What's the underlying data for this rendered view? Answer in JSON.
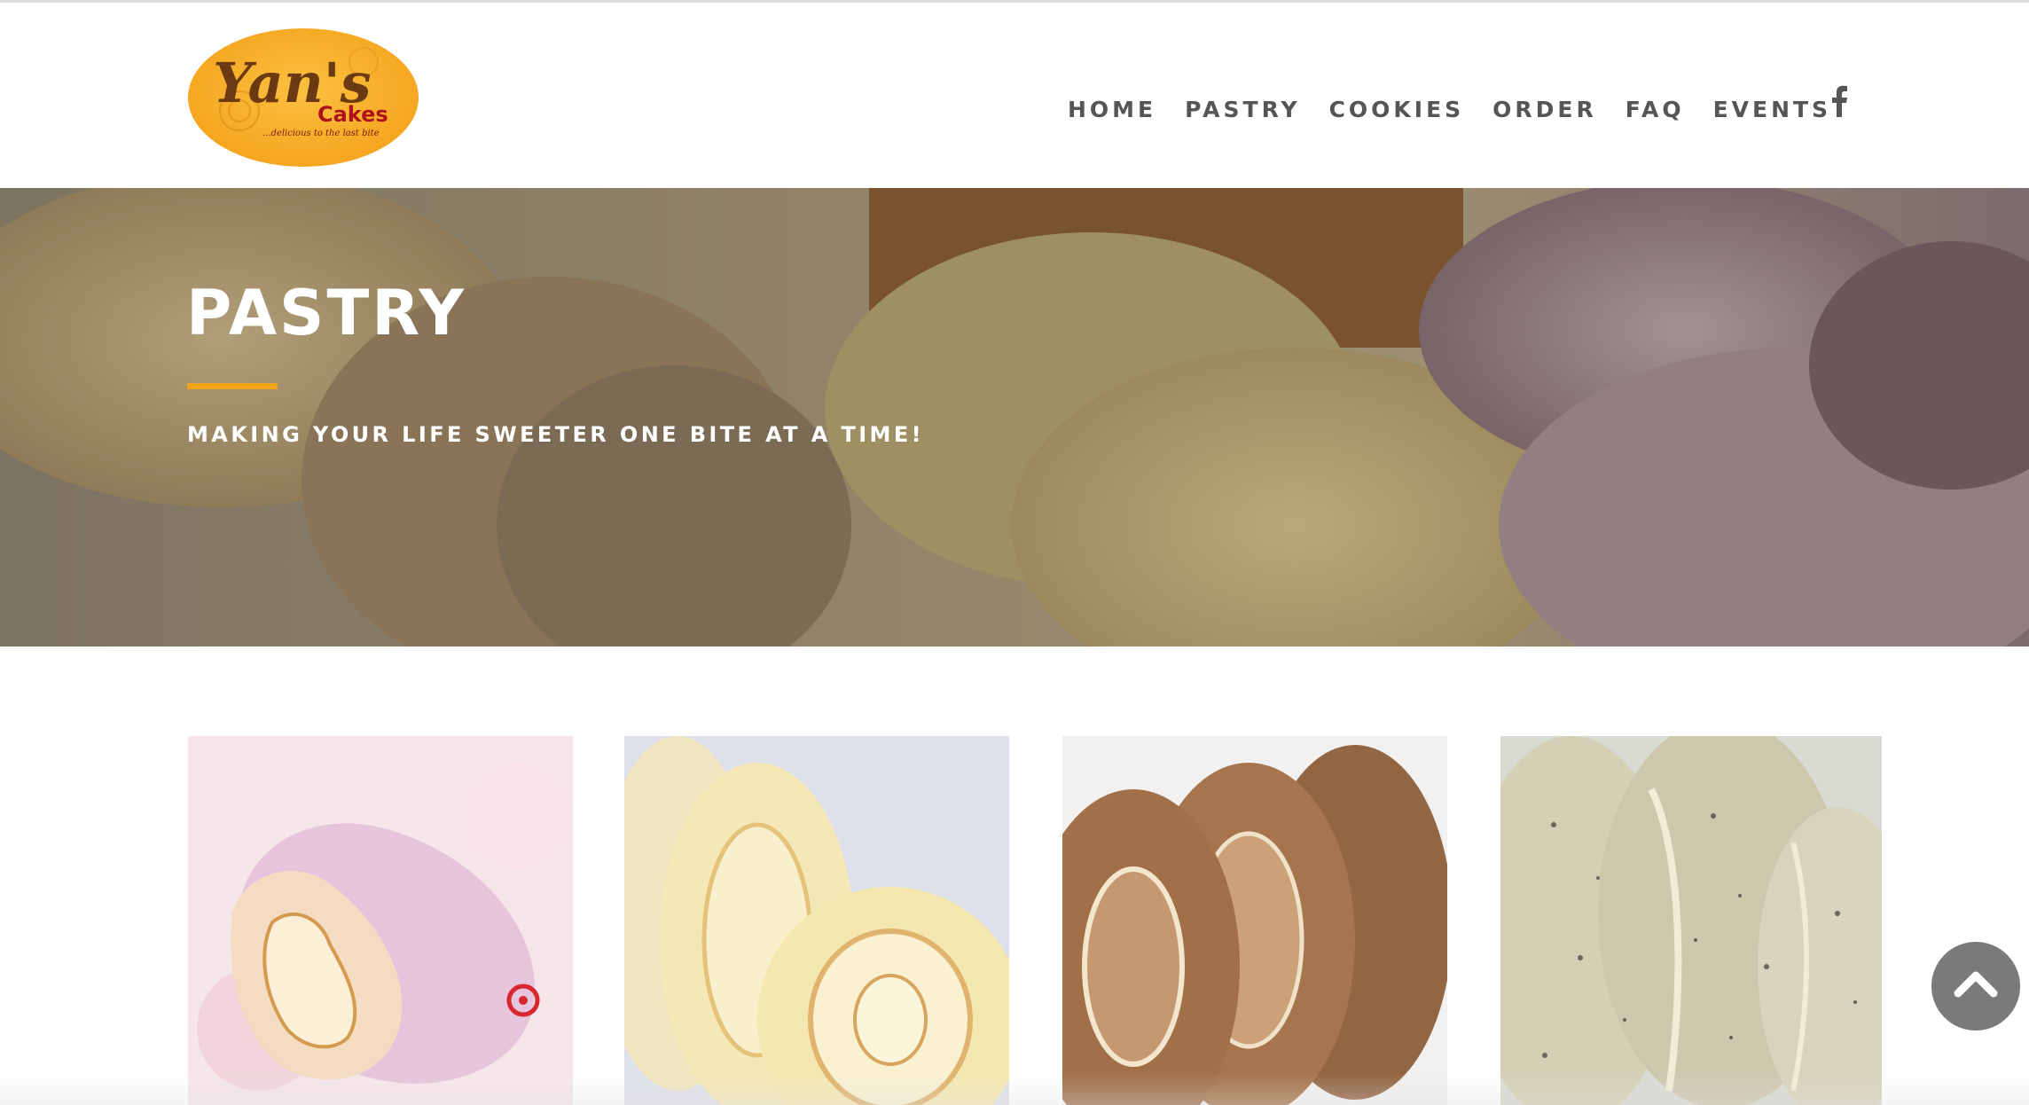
{
  "brand": {
    "logo_name": "Yan's",
    "logo_sub": "Cakes",
    "logo_tagline": "...delicious to the last bite",
    "accent": "#f2a51a"
  },
  "nav": {
    "items": [
      {
        "label": "HOME"
      },
      {
        "label": "PASTRY"
      },
      {
        "label": "COOKIES"
      },
      {
        "label": "ORDER"
      },
      {
        "label": "FAQ"
      },
      {
        "label": "EVENTS"
      }
    ],
    "social_icon": "facebook-icon"
  },
  "hero": {
    "title": "PASTRY",
    "subtitle": "MAKING YOUR LIFE SWEETER ONE BITE AT A TIME!"
  },
  "products": [
    {
      "image": "pink-roll-cake-image"
    },
    {
      "image": "vanilla-roll-cake-image"
    },
    {
      "image": "mocha-roll-cake-image"
    },
    {
      "image": "cookies-and-cream-roll-cake-image"
    }
  ],
  "scroll_top_icon": "chevron-up-icon"
}
